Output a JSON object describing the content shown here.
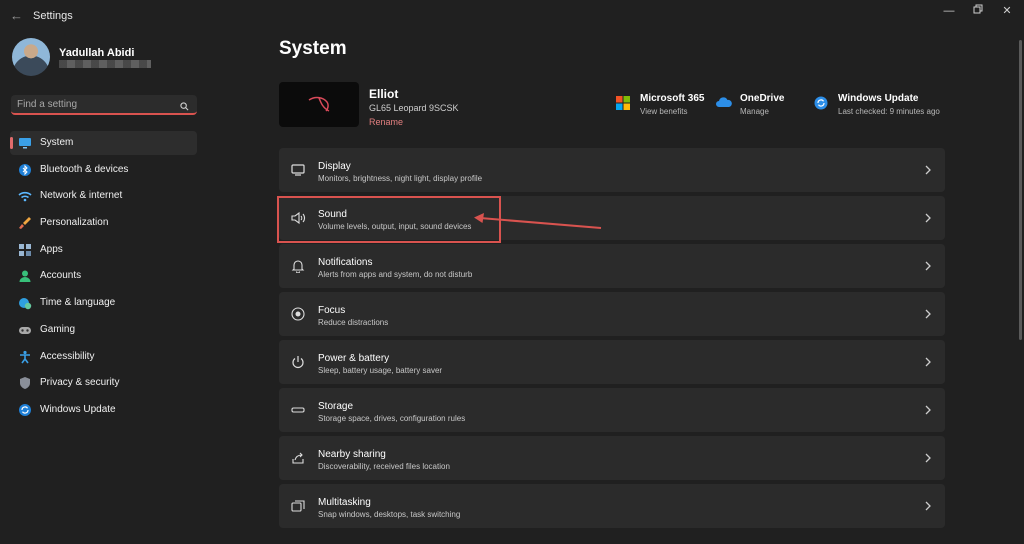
{
  "app": {
    "title": "Settings"
  },
  "profile": {
    "name": "Yadullah Abidi"
  },
  "search": {
    "placeholder": "Find a setting"
  },
  "sidebar": {
    "items": [
      {
        "label": "System",
        "icon": "monitor-icon",
        "active": true
      },
      {
        "label": "Bluetooth & devices",
        "icon": "bluetooth-icon"
      },
      {
        "label": "Network & internet",
        "icon": "wifi-icon"
      },
      {
        "label": "Personalization",
        "icon": "brush-icon"
      },
      {
        "label": "Apps",
        "icon": "apps-icon"
      },
      {
        "label": "Accounts",
        "icon": "person-icon"
      },
      {
        "label": "Time & language",
        "icon": "globe-clock-icon"
      },
      {
        "label": "Gaming",
        "icon": "gamepad-icon"
      },
      {
        "label": "Accessibility",
        "icon": "accessibility-icon"
      },
      {
        "label": "Privacy & security",
        "icon": "shield-icon"
      },
      {
        "label": "Windows Update",
        "icon": "update-icon"
      }
    ]
  },
  "main": {
    "title": "System",
    "device": {
      "name": "Elliot",
      "model": "GL65 Leopard 9SCSK",
      "rename": "Rename"
    },
    "quick_links": [
      {
        "title": "Microsoft 365",
        "subtitle": "View benefits",
        "icon": "microsoft-365-icon"
      },
      {
        "title": "OneDrive",
        "subtitle": "Manage",
        "icon": "onedrive-icon"
      },
      {
        "title": "Windows Update",
        "subtitle": "Last checked: 9 minutes ago",
        "icon": "windows-update-icon"
      }
    ],
    "cards": [
      {
        "title": "Display",
        "subtitle": "Monitors, brightness, night light, display profile",
        "icon": "display-icon"
      },
      {
        "title": "Sound",
        "subtitle": "Volume levels, output, input, sound devices",
        "icon": "speaker-icon"
      },
      {
        "title": "Notifications",
        "subtitle": "Alerts from apps and system, do not disturb",
        "icon": "bell-icon"
      },
      {
        "title": "Focus",
        "subtitle": "Reduce distractions",
        "icon": "focus-icon"
      },
      {
        "title": "Power & battery",
        "subtitle": "Sleep, battery usage, battery saver",
        "icon": "power-icon"
      },
      {
        "title": "Storage",
        "subtitle": "Storage space, drives, configuration rules",
        "icon": "storage-icon"
      },
      {
        "title": "Nearby sharing",
        "subtitle": "Discoverability, received files location",
        "icon": "share-icon"
      },
      {
        "title": "Multitasking",
        "subtitle": "Snap windows, desktops, task switching",
        "icon": "multitasking-icon"
      }
    ]
  },
  "colors": {
    "background": "#202020",
    "card": "#2b2b2b",
    "accent": "#e06b6b",
    "annotation": "#d9534f"
  }
}
